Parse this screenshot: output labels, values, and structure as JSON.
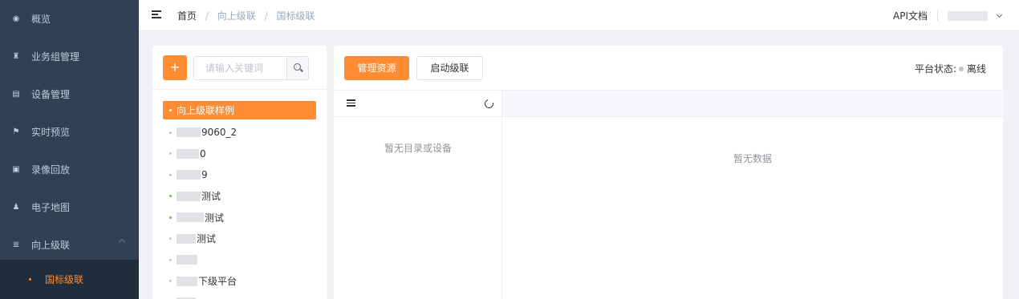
{
  "sidebar": {
    "items": [
      {
        "label": "概览",
        "icon": "dashboard-icon",
        "glyph": "◉"
      },
      {
        "label": "业务组管理",
        "icon": "org-icon",
        "glyph": "♜"
      },
      {
        "label": "设备管理",
        "icon": "device-icon",
        "glyph": "▤"
      },
      {
        "label": "实时预览",
        "icon": "flag-icon",
        "glyph": "⚑"
      },
      {
        "label": "录像回放",
        "icon": "video-icon",
        "glyph": "▣"
      },
      {
        "label": "电子地图",
        "icon": "map-person-icon",
        "glyph": "♟"
      },
      {
        "label": "向上级联",
        "icon": "cascade-icon",
        "glyph": "≣"
      }
    ],
    "sub_item": "国标级联"
  },
  "header": {
    "breadcrumb": [
      "首页",
      "向上级联",
      "国标级联"
    ],
    "separator": "/",
    "api_doc": "API文档"
  },
  "left_panel": {
    "add_label": "+",
    "search_placeholder": "请输入关键词",
    "tree": [
      {
        "label": "向上级联样例",
        "active": true,
        "status": "active"
      },
      {
        "label": "9060_2",
        "status": "offline",
        "blur": 30
      },
      {
        "label": "0",
        "status": "offline",
        "blur": 28
      },
      {
        "label": "9",
        "status": "offline",
        "blur": 30
      },
      {
        "label": "测试",
        "status": "online",
        "blur": 30
      },
      {
        "label": "测试",
        "status": "online",
        "blur": 34
      },
      {
        "label": "测试",
        "status": "offline",
        "blur": 24
      },
      {
        "label": "",
        "status": "offline",
        "blur": 26
      },
      {
        "label": "下级平台",
        "status": "offline",
        "blur": 26
      },
      {
        "label": "",
        "status": "offline",
        "blur": 24
      }
    ]
  },
  "right_panel": {
    "manage_btn": "管理资源",
    "start_btn": "启动级联",
    "status_label": "平台状态:",
    "status_value": "离线",
    "catalog_empty": "暂无目录或设备",
    "data_empty": "暂无数据"
  },
  "colors": {
    "accent": "#ff8b33",
    "sidebar_bg": "#304156",
    "online": "#67c23a"
  }
}
